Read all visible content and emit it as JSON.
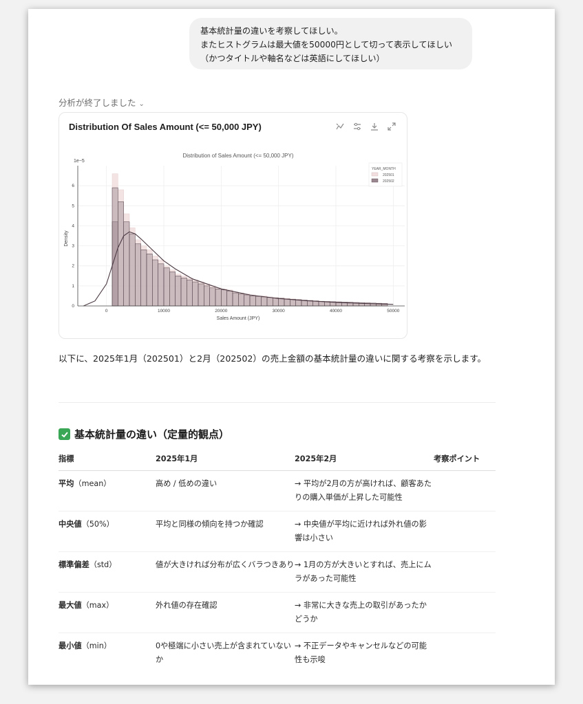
{
  "user_message": {
    "lines": [
      "基本統計量の違いを考察してほしい。",
      "またヒストグラムは最大値を50000円として切って表示してほしい",
      "（かつタイトルや軸名などは英語にしてほしい）"
    ]
  },
  "status": {
    "label": "分析が終了しました",
    "chevron_icon": "chevron-down-icon"
  },
  "chart_card": {
    "title": "Distribution Of Sales Amount (<= 50,000 JPY)",
    "tools": [
      "chart-type-icon",
      "filter-icon",
      "download-icon",
      "expand-icon"
    ]
  },
  "chart_data": {
    "type": "bar",
    "title": "Distribution of Sales Amount (<= 50,000 JPY)",
    "xlabel": "Sales Amount (JPY)",
    "ylabel": "Density",
    "y_scale_label": "1e−5",
    "xlim": [
      -5000,
      52000
    ],
    "ylim": [
      0,
      7
    ],
    "x_ticks": [
      0,
      10000,
      20000,
      30000,
      40000,
      50000
    ],
    "y_ticks": [
      0,
      1,
      2,
      3,
      4,
      5,
      6
    ],
    "bin_edges": [
      1000,
      2000,
      3000,
      4000,
      5000,
      6000,
      7000,
      8000,
      9000,
      10000,
      11000,
      12000,
      13000,
      14000,
      15000,
      16000,
      17000,
      18000,
      19000,
      20000,
      21000,
      22000,
      23000,
      24000,
      25000,
      26000,
      27000,
      28000,
      29000,
      30000,
      31000,
      32000,
      33000,
      34000,
      35000,
      36000,
      37000,
      38000,
      39000,
      40000,
      41000,
      42000,
      43000,
      44000,
      45000,
      46000,
      47000,
      48000,
      49000,
      50000
    ],
    "series": [
      {
        "name": "202501",
        "color": "#f2dede",
        "values": [
          4.2,
          6.6,
          5.8,
          4.6,
          3.9,
          3.3,
          3.0,
          2.8,
          2.5,
          2.3,
          2.0,
          1.8,
          1.6,
          1.5,
          1.4,
          1.3,
          1.2,
          1.1,
          1.0,
          0.9,
          0.85,
          0.8,
          0.7,
          0.65,
          0.6,
          0.55,
          0.5,
          0.5,
          0.45,
          0.42,
          0.4,
          0.38,
          0.35,
          0.33,
          0.3,
          0.28,
          0.26,
          0.24,
          0.23,
          0.22,
          0.21,
          0.2,
          0.19,
          0.18,
          0.17,
          0.16,
          0.15,
          0.14,
          0.13
        ]
      },
      {
        "name": "202502",
        "color": "#9a8790",
        "values": [
          4.2,
          5.9,
          5.2,
          4.2,
          3.6,
          3.1,
          2.8,
          2.6,
          2.3,
          2.1,
          1.9,
          1.7,
          1.5,
          1.4,
          1.3,
          1.2,
          1.1,
          1.0,
          0.9,
          0.85,
          0.8,
          0.75,
          0.65,
          0.6,
          0.55,
          0.5,
          0.48,
          0.45,
          0.42,
          0.4,
          0.38,
          0.35,
          0.33,
          0.31,
          0.29,
          0.27,
          0.25,
          0.23,
          0.22,
          0.21,
          0.2,
          0.19,
          0.18,
          0.17,
          0.16,
          0.15,
          0.14,
          0.13,
          0.12
        ]
      }
    ],
    "kde_x": [
      -4000,
      -2000,
      0,
      1000,
      2000,
      3000,
      4000,
      5000,
      6000,
      8000,
      10000,
      12000,
      15000,
      20000,
      25000,
      30000,
      35000,
      40000,
      45000,
      50000
    ],
    "kde_y": [
      0.0,
      0.25,
      1.1,
      2.0,
      2.9,
      3.5,
      3.7,
      3.6,
      3.35,
      2.8,
      2.25,
      1.85,
      1.35,
      0.85,
      0.55,
      0.37,
      0.26,
      0.18,
      0.12,
      0.08
    ],
    "legend": {
      "title": "YEAR_MONTH",
      "position": "top-right",
      "entries": [
        "202501",
        "202502"
      ]
    },
    "grid": true
  },
  "summary_text": "以下に、2025年1月（202501）と2月（202502）の売上金額の基本統計量の違いに関する考察を示します。",
  "section": {
    "title": "基本統計量の違い（定量的観点）",
    "icon": "check-mark-icon"
  },
  "table": {
    "headers": [
      "指標",
      "2025年1月",
      "2025年2月",
      "考察ポイント"
    ],
    "rows": [
      {
        "metric": "平均",
        "metric_sub": "（mean）",
        "jan": "高め / 低めの違い",
        "feb": "→ 平均が2月の方が高ければ、顧客あたりの購入単価が上昇した可能性",
        "point": ""
      },
      {
        "metric": "中央値",
        "metric_sub": "（50%）",
        "jan": "平均と同様の傾向を持つか確認",
        "feb": "→ 中央値が平均に近ければ外れ値の影響は小さい",
        "point": ""
      },
      {
        "metric": "標準偏差",
        "metric_sub": "（std）",
        "jan": "値が大きければ分布が広くバラつきあり",
        "feb": "→ 1月の方が大きいとすれば、売上にムラがあった可能性",
        "point": ""
      },
      {
        "metric": "最大値",
        "metric_sub": "（max）",
        "jan": "外れ値の存在確認",
        "feb": "→ 非常に大きな売上の取引があったかどうか",
        "point": ""
      },
      {
        "metric": "最小値",
        "metric_sub": "（min）",
        "jan": "0や極端に小さい売上が含まれていないか",
        "feb": "→ 不正データやキャンセルなどの可能性も示唆",
        "point": ""
      }
    ]
  }
}
